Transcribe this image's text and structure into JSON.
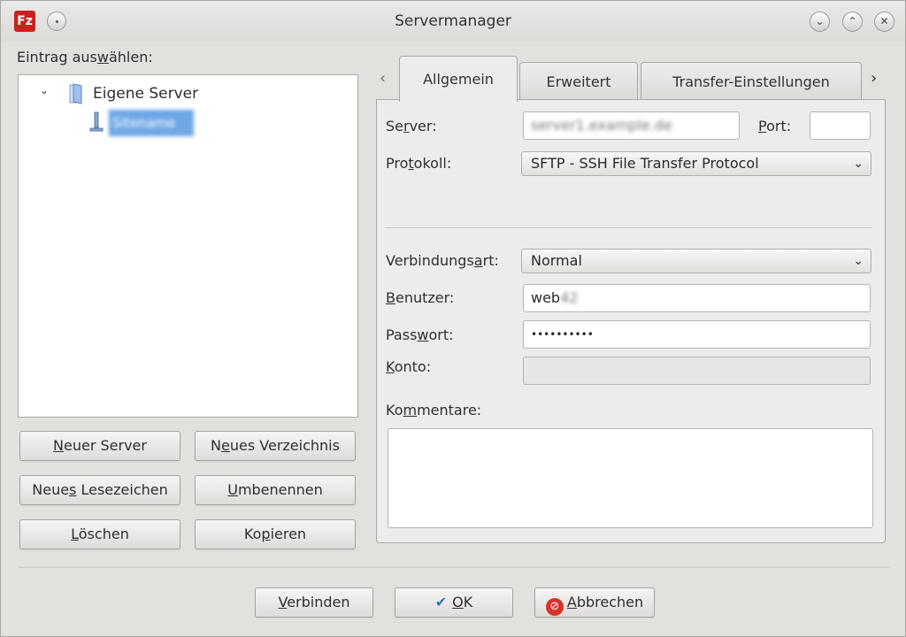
{
  "window": {
    "title": "Servermanager",
    "app_icon_text": "Fz",
    "accent_color": "#6fa7e6"
  },
  "left": {
    "select_label_pre": "Eintrag aus",
    "select_label_u": "w",
    "select_label_post": "ählen:",
    "tree": {
      "root_label": "Eigene Server",
      "selected_item": "Sitename"
    },
    "buttons": {
      "new_server": {
        "pre": "",
        "u": "N",
        "post": "euer Server"
      },
      "new_folder": {
        "pre": "N",
        "u": "e",
        "post": "ues Verzeichnis"
      },
      "new_bookmark": {
        "pre": "Neue",
        "u": "s",
        "post": " Lesezeichen"
      },
      "rename": {
        "pre": "",
        "u": "U",
        "post": "mbenennen"
      },
      "delete": {
        "pre": "",
        "u": "L",
        "post": "öschen"
      },
      "copy": {
        "pre": "Ko",
        "u": "p",
        "post": "ieren"
      }
    }
  },
  "tabs": {
    "general": "Allgemein",
    "advanced": "Erweitert",
    "transfer": "Transfer-Einstellungen"
  },
  "general": {
    "server": {
      "label_pre": "Se",
      "label_u": "r",
      "label_post": "ver:",
      "value": "server1.example.de"
    },
    "port": {
      "label_pre": "",
      "label_u": "P",
      "label_post": "ort:",
      "value": ""
    },
    "protocol": {
      "label_pre": "Pro",
      "label_u": "t",
      "label_post": "okoll:",
      "value": "SFTP - SSH File Transfer Protocol"
    },
    "logon_type": {
      "label_pre": "Verbindungs",
      "label_u": "a",
      "label_post": "rt:",
      "value": "Normal"
    },
    "user": {
      "label_pre": "",
      "label_u": "B",
      "label_post": "enutzer:",
      "value": "web",
      "value_hidden": "42"
    },
    "password": {
      "label_pre": "Pass",
      "label_u": "w",
      "label_post": "ort:",
      "value": "••••••••••"
    },
    "account": {
      "label_pre": "",
      "label_u": "K",
      "label_post": "onto:",
      "value": ""
    },
    "comments": {
      "label_pre": "Ko",
      "label_u": "m",
      "label_post": "mentare:",
      "value": ""
    }
  },
  "footer": {
    "connect": {
      "pre": "",
      "u": "V",
      "post": "erbinden"
    },
    "ok": {
      "pre": "",
      "u": "O",
      "post": "K"
    },
    "cancel": {
      "pre": "",
      "u": "A",
      "post": "bbrechen"
    }
  }
}
